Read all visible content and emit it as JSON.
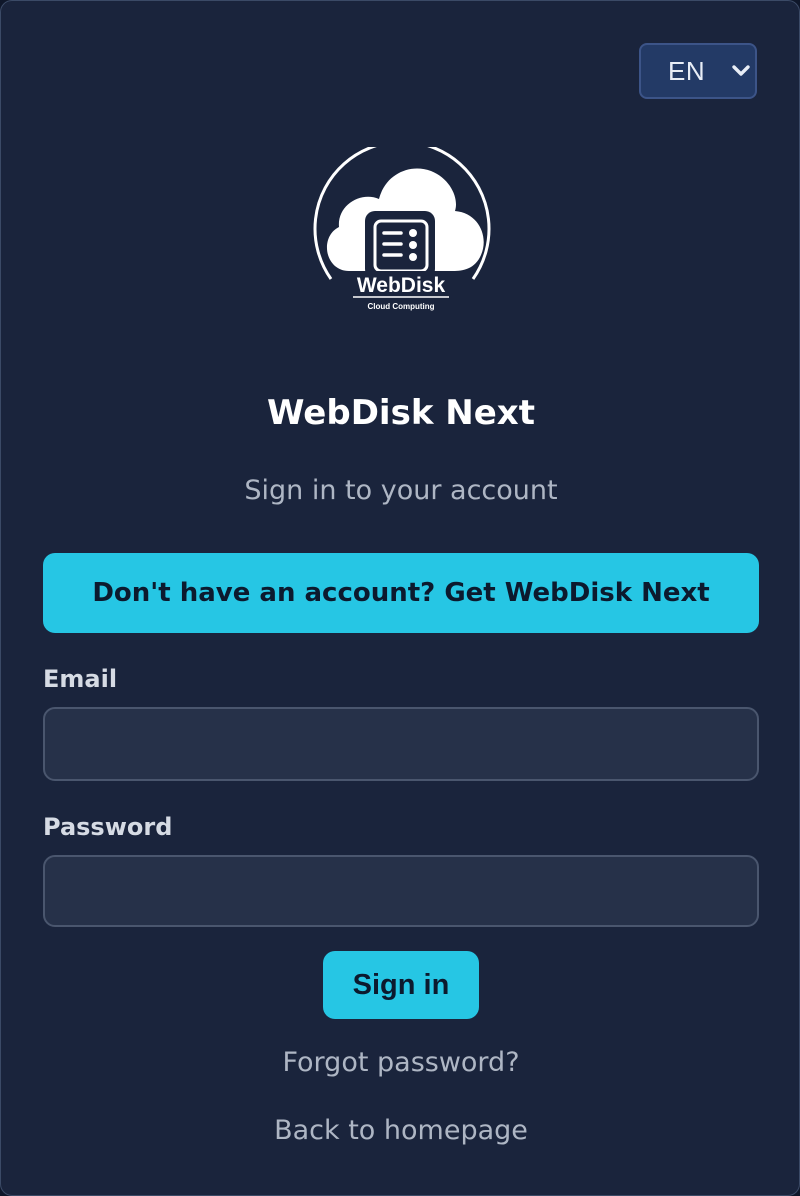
{
  "language": {
    "selected": "EN"
  },
  "brand": {
    "logo_wordmark": "WebDisk",
    "logo_tagline": "Cloud Computing",
    "app_title": "WebDisk Next",
    "subtitle": "Sign in to your account"
  },
  "cta": {
    "get_account_label": "Don't have an account? Get WebDisk Next"
  },
  "form": {
    "email_label": "Email",
    "email_value": "",
    "password_label": "Password",
    "password_value": "",
    "submit_label": "Sign in"
  },
  "links": {
    "forgot_password": "Forgot password?",
    "back_home": "Back to homepage"
  },
  "colors": {
    "background": "#1a243c",
    "accent": "#26c6e4",
    "input_bg": "#263149",
    "muted_text": "#aeb6c4"
  }
}
